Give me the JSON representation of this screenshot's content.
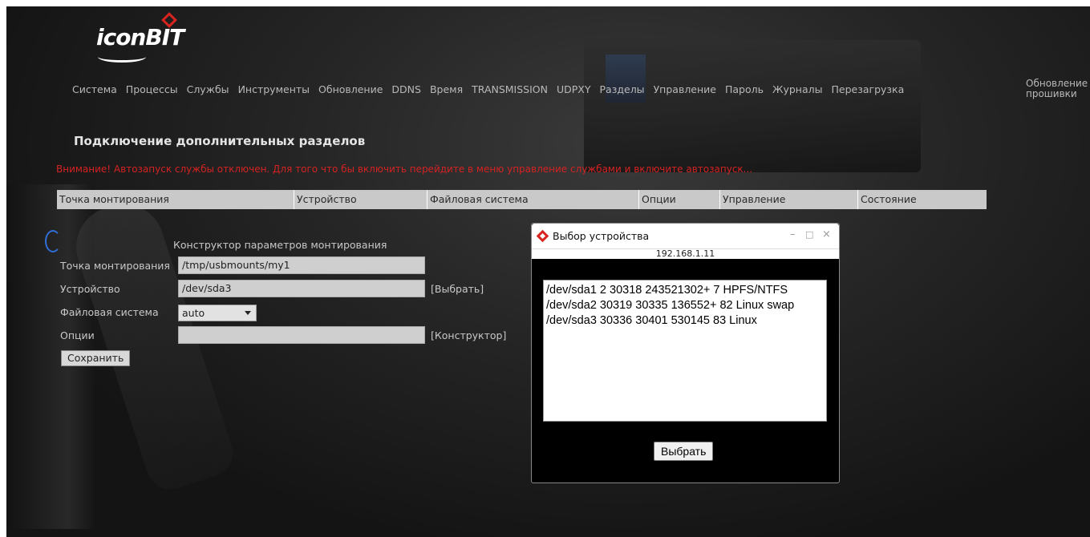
{
  "logo": {
    "text": "iconBIT"
  },
  "nav": {
    "items": [
      "Система",
      "Процессы",
      "Службы",
      "Инструменты",
      "Обновление",
      "DDNS",
      "Время",
      "TRANSMISSION",
      "UDPXY",
      "Разделы",
      "Управление",
      "Пароль",
      "Журналы",
      "Перезагрузка"
    ],
    "last_line1": "Обновление",
    "last_line2": "прошивки"
  },
  "page": {
    "title": "Подключение дополнительных разделов",
    "warning": "Внимание! Автозапуск службы отключен. Для того что бы включить перейдите в меню управление службами и включите автозапуск..."
  },
  "table": {
    "headers": [
      "Точка монтирования",
      "Устройство",
      "Файловая система",
      "Опции",
      "Управление",
      "Состояние"
    ]
  },
  "form": {
    "title": "Конструктор параметров монтирования",
    "mount_label": "Точка монтирования",
    "mount_value": "/tmp/usbmounts/my1",
    "device_label": "Устройство",
    "device_value": "/dev/sda3",
    "choose_link": "[Выбрать]",
    "fs_label": "Файловая система",
    "fs_value": "auto",
    "options_label": "Опции",
    "options_value": "",
    "constructor_link": "[Конструктор]",
    "save_label": "Сохранить"
  },
  "popup": {
    "title": "Выбор устройства",
    "address": "192.168.1.11",
    "devices": [
      "/dev/sda1 2 30318 243521302+ 7 HPFS/NTFS",
      "/dev/sda2 30319 30335 136552+ 82 Linux swap",
      "/dev/sda3 30336 30401 530145 83 Linux"
    ],
    "select_label": "Выбрать"
  },
  "colors": {
    "warning": "#d42222",
    "table_header": "#c9c9c9",
    "logo_accent": "#d8231f"
  }
}
